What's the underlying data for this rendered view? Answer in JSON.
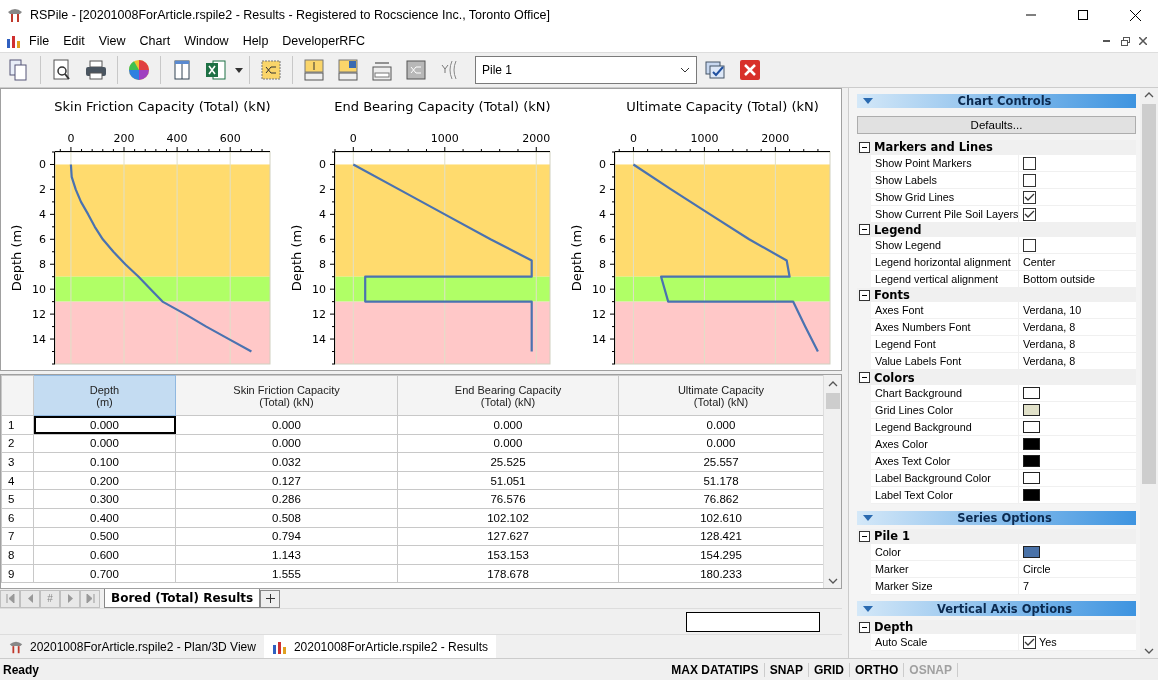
{
  "window": {
    "title": "RSPile - [20201008ForArticle.rspile2 - Results - Registered to Rocscience Inc., Toronto Office]"
  },
  "menu": [
    "File",
    "Edit",
    "View",
    "Chart",
    "Window",
    "Help",
    "DeveloperRFC"
  ],
  "toolbar": {
    "pile_select": {
      "value": "Pile 1"
    }
  },
  "charts": [
    {
      "chart_data": {
        "type": "line",
        "orientation": "horizontal",
        "title": "Skin Friction Capacity (Total) (kN)",
        "ylabel": "Depth (m)",
        "x": [
          0,
          1,
          2,
          3,
          4,
          5,
          6,
          7,
          8,
          9,
          10,
          11,
          12,
          13,
          14,
          15
        ],
        "series": [
          {
            "color": "#4a72b0",
            "values": [
              0,
              3,
              18,
              38,
              65,
              90,
              120,
              160,
              205,
              255,
              300,
              345,
              430,
              510,
              595,
              680
            ]
          }
        ],
        "xlim": [
          -60,
          750
        ],
        "ylim": [
          16,
          -1
        ],
        "xticks": [
          0,
          200,
          400,
          600
        ],
        "yticks": [
          0,
          2,
          4,
          6,
          8,
          10,
          12,
          14
        ],
        "grid": true,
        "bands": [
          {
            "axis": "y",
            "from": 0,
            "to": 9,
            "color": "#ffdb6e"
          },
          {
            "axis": "y",
            "from": 9,
            "to": 11,
            "color": "#b0ff66"
          },
          {
            "axis": "y",
            "from": 11,
            "to": 16,
            "color": "#ffc8c8"
          }
        ]
      }
    },
    {
      "chart_data": {
        "type": "line",
        "orientation": "horizontal",
        "title": "End Bearing Capacity (Total) (kN)",
        "ylabel": "Depth (m)",
        "x": [
          0,
          2,
          4,
          6,
          7.7,
          9,
          9,
          11,
          11,
          13,
          15
        ],
        "series": [
          {
            "color": "#4a72b0",
            "values": [
              0,
              500,
              1000,
              1500,
              1950,
              1950,
              130,
              130,
              1950,
              1950,
              1950
            ]
          }
        ],
        "xlim": [
          -200,
          2150
        ],
        "ylim": [
          16,
          -1
        ],
        "xticks": [
          0,
          1000,
          2000
        ],
        "yticks": [
          0,
          2,
          4,
          6,
          8,
          10,
          12,
          14
        ],
        "grid": true,
        "bands": [
          {
            "axis": "y",
            "from": 0,
            "to": 9,
            "color": "#ffdb6e"
          },
          {
            "axis": "y",
            "from": 9,
            "to": 11,
            "color": "#b0ff66"
          },
          {
            "axis": "y",
            "from": 11,
            "to": 16,
            "color": "#ffc8c8"
          }
        ]
      }
    },
    {
      "chart_data": {
        "type": "line",
        "orientation": "horizontal",
        "title": "Ultimate Capacity (Total) (kN)",
        "ylabel": "Depth (m)",
        "x": [
          0,
          2,
          4,
          6,
          7.7,
          9,
          9,
          11,
          11,
          13,
          15
        ],
        "series": [
          {
            "color": "#4a72b0",
            "values": [
              0,
              530,
              1080,
              1630,
              2160,
              2200,
              390,
              490,
              2250,
              2420,
              2600
            ]
          }
        ],
        "xlim": [
          -260,
          2770
        ],
        "ylim": [
          16,
          -1
        ],
        "xticks": [
          0,
          1000,
          2000
        ],
        "yticks": [
          0,
          2,
          4,
          6,
          8,
          10,
          12,
          14
        ],
        "grid": true,
        "bands": [
          {
            "axis": "y",
            "from": 0,
            "to": 9,
            "color": "#ffdb6e"
          },
          {
            "axis": "y",
            "from": 9,
            "to": 11,
            "color": "#b0ff66"
          },
          {
            "axis": "y",
            "from": 11,
            "to": 16,
            "color": "#ffc8c8"
          }
        ]
      }
    }
  ],
  "table": {
    "columns": [
      {
        "label": "Depth\n(m)",
        "selected": true
      },
      {
        "label": "Skin Friction Capacity\n(Total) (kN)",
        "selected": false
      },
      {
        "label": "End Bearing Capacity\n(Total) (kN)",
        "selected": false
      },
      {
        "label": "Ultimate Capacity\n(Total) (kN)",
        "selected": false
      }
    ],
    "rows": [
      {
        "index": "1",
        "cells": [
          "0.000",
          "0.000",
          "0.000",
          "0.000"
        ]
      },
      {
        "index": "2",
        "cells": [
          "0.000",
          "0.000",
          "0.000",
          "0.000"
        ]
      },
      {
        "index": "3",
        "cells": [
          "0.100",
          "0.032",
          "25.525",
          "25.557"
        ]
      },
      {
        "index": "4",
        "cells": [
          "0.200",
          "0.127",
          "51.051",
          "51.178"
        ]
      },
      {
        "index": "5",
        "cells": [
          "0.300",
          "0.286",
          "76.576",
          "76.862"
        ]
      },
      {
        "index": "6",
        "cells": [
          "0.400",
          "0.508",
          "102.102",
          "102.610"
        ]
      },
      {
        "index": "7",
        "cells": [
          "0.500",
          "0.794",
          "127.627",
          "128.421"
        ]
      },
      {
        "index": "8",
        "cells": [
          "0.600",
          "1.143",
          "153.153",
          "154.295"
        ]
      },
      {
        "index": "9",
        "cells": [
          "0.700",
          "1.555",
          "178.678",
          "180.233"
        ]
      }
    ]
  },
  "sheet_nav": {
    "number_label": "#"
  },
  "sheet_tabs": [
    {
      "label": "Bored (Total) Results",
      "selected": true
    }
  ],
  "documents": [
    {
      "label": "20201008ForArticle.rspile2 - Plan/3D View",
      "kind": "plan",
      "selected": false
    },
    {
      "label": "20201008ForArticle.rspile2 - Results",
      "kind": "results",
      "selected": true
    }
  ],
  "panel": {
    "sections": [
      {
        "title": "Chart Controls",
        "button": "Defaults...",
        "groups": [
          {
            "title": "Markers and Lines",
            "expanded": true,
            "rows": [
              {
                "label": "Show Point Markers",
                "kind": "checkbox",
                "checked": false
              },
              {
                "label": "Show Labels",
                "kind": "checkbox",
                "checked": false
              },
              {
                "label": "Show Grid Lines",
                "kind": "checkbox",
                "checked": true
              },
              {
                "label": "Show Current Pile Soil Layers",
                "kind": "checkbox",
                "checked": true
              }
            ]
          },
          {
            "title": "Legend",
            "expanded": true,
            "rows": [
              {
                "label": "Show Legend",
                "kind": "checkbox",
                "checked": false
              },
              {
                "label": "Legend horizontal alignment",
                "kind": "text",
                "value": "Center"
              },
              {
                "label": "Legend vertical alignment",
                "kind": "text",
                "value": "Bottom outside"
              }
            ]
          },
          {
            "title": "Fonts",
            "expanded": true,
            "rows": [
              {
                "label": "Axes Font",
                "kind": "text",
                "value": "Verdana, 10"
              },
              {
                "label": "Axes Numbers Font",
                "kind": "text",
                "value": "Verdana, 8"
              },
              {
                "label": "Legend Font",
                "kind": "text",
                "value": "Verdana, 8"
              },
              {
                "label": "Value Labels Font",
                "kind": "text",
                "value": "Verdana, 8"
              }
            ]
          },
          {
            "title": "Colors",
            "expanded": true,
            "rows": [
              {
                "label": "Chart Background",
                "kind": "color",
                "color": "#ffffff"
              },
              {
                "label": "Grid Lines Color",
                "kind": "color",
                "color": "#e0e0c8"
              },
              {
                "label": "Legend Background",
                "kind": "color",
                "color": "#ffffff"
              },
              {
                "label": "Axes Color",
                "kind": "color",
                "color": "#000000"
              },
              {
                "label": "Axes Text Color",
                "kind": "color",
                "color": "#000000"
              },
              {
                "label": "Label Background Color",
                "kind": "color",
                "color": "#ffffff"
              },
              {
                "label": "Label Text Color",
                "kind": "color",
                "color": "#000000"
              }
            ]
          }
        ]
      },
      {
        "title": "Series Options",
        "groups": [
          {
            "title": "Pile 1",
            "expanded": true,
            "rows": [
              {
                "label": "Color",
                "kind": "color",
                "color": "#4a72a8"
              },
              {
                "label": "Marker",
                "kind": "text",
                "value": "Circle"
              },
              {
                "label": "Marker Size",
                "kind": "text",
                "value": "7"
              }
            ]
          }
        ]
      },
      {
        "title": "Vertical Axis Options",
        "groups": [
          {
            "title": "Depth",
            "expanded": true,
            "rows": [
              {
                "label": "Auto Scale",
                "kind": "checkbox",
                "checked": true,
                "value": "Yes"
              }
            ]
          }
        ]
      }
    ]
  },
  "status_bar": {
    "text": "Ready",
    "indicators": [
      {
        "label": "MAX DATATIPS",
        "on": true
      },
      {
        "label": "SNAP",
        "on": true
      },
      {
        "label": "GRID",
        "on": true
      },
      {
        "label": "ORTHO",
        "on": true
      },
      {
        "label": "OSNAP",
        "on": false
      }
    ]
  }
}
